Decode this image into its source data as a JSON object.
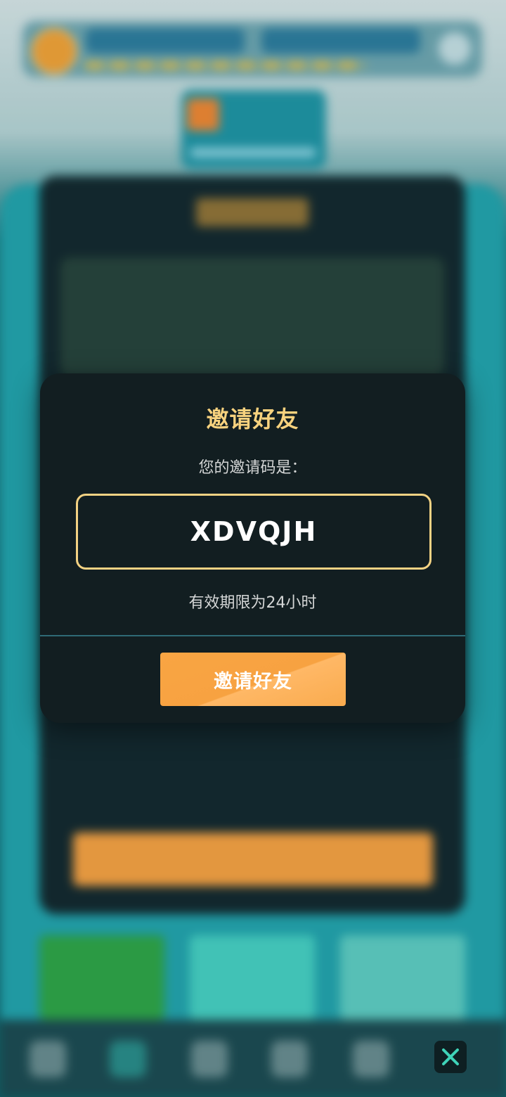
{
  "modal": {
    "title": "邀请好友",
    "subtitle": "您的邀请码是：",
    "invite_code": "XDVQJH",
    "validity_note": "有效期限为24小时",
    "invite_button_label": "邀请好友"
  },
  "overlay_controls": {
    "close_icon": "close-x-icon"
  },
  "colors": {
    "modal_background": "#121e21",
    "title_gold": "#f7d27e",
    "code_border": "#f3d283",
    "button_orange": "#f9a543",
    "close_accent": "#3fd3b8"
  }
}
